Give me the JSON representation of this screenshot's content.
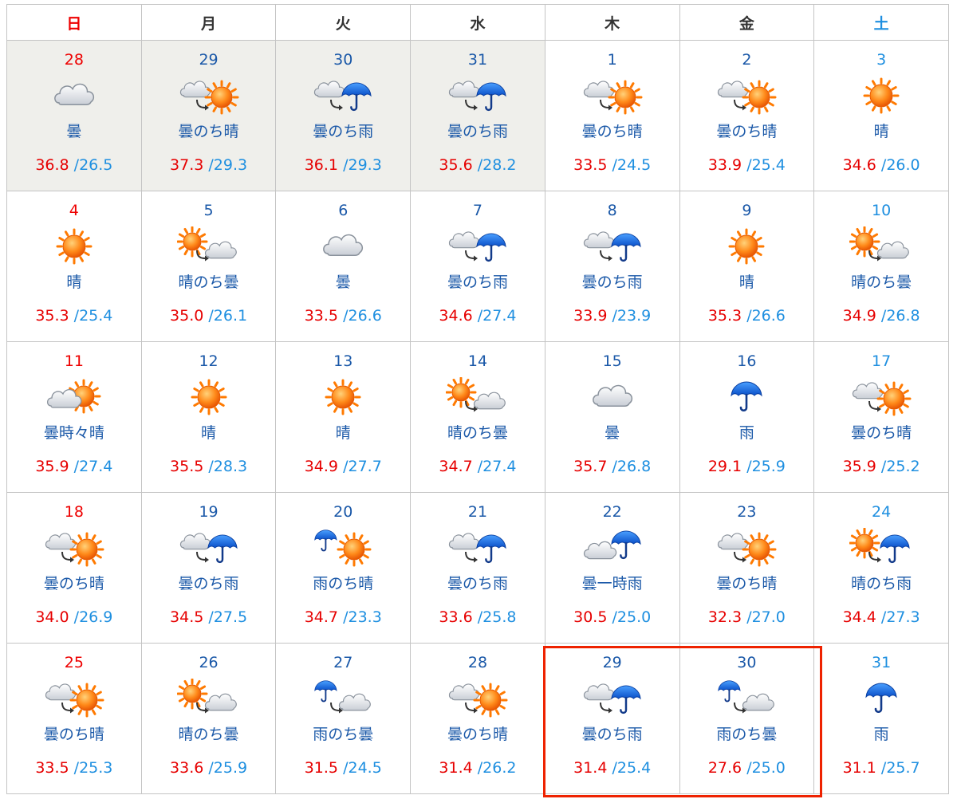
{
  "weekdays": [
    "日",
    "月",
    "火",
    "水",
    "木",
    "金",
    "土"
  ],
  "colors": {
    "sunday": "#ee0000",
    "saturday": "#1e8fe0",
    "weekday": "#1a58a8",
    "max_temp": "#e60000",
    "min_temp": "#1e8fe0",
    "past_bg": "#efefeb",
    "highlight": "#ee2200"
  },
  "weeks": [
    [
      {
        "day": "28",
        "icon": "cloud-icon",
        "label": "曇",
        "max": "36.8",
        "min": "/26.5",
        "past": true
      },
      {
        "day": "29",
        "icon": "cloud-then-sun-icon",
        "label": "曇のち晴",
        "max": "37.3",
        "min": "/29.3",
        "past": true
      },
      {
        "day": "30",
        "icon": "cloud-then-rain-icon",
        "label": "曇のち雨",
        "max": "36.1",
        "min": "/29.3",
        "past": true
      },
      {
        "day": "31",
        "icon": "cloud-then-rain-icon",
        "label": "曇のち雨",
        "max": "35.6",
        "min": "/28.2",
        "past": true
      },
      {
        "day": "1",
        "icon": "cloud-then-sun-icon",
        "label": "曇のち晴",
        "max": "33.5",
        "min": "/24.5",
        "past": false
      },
      {
        "day": "2",
        "icon": "cloud-then-sun-icon",
        "label": "曇のち晴",
        "max": "33.9",
        "min": "/25.4",
        "past": false
      },
      {
        "day": "3",
        "icon": "sun-icon",
        "label": "晴",
        "max": "34.6",
        "min": "/26.0",
        "past": false
      }
    ],
    [
      {
        "day": "4",
        "icon": "sun-icon",
        "label": "晴",
        "max": "35.3",
        "min": "/25.4",
        "past": false
      },
      {
        "day": "5",
        "icon": "sun-then-cloud-icon",
        "label": "晴のち曇",
        "max": "35.0",
        "min": "/26.1",
        "past": false
      },
      {
        "day": "6",
        "icon": "cloud-icon",
        "label": "曇",
        "max": "33.5",
        "min": "/26.6",
        "past": false
      },
      {
        "day": "7",
        "icon": "cloud-then-rain-icon",
        "label": "曇のち雨",
        "max": "34.6",
        "min": "/27.4",
        "past": false
      },
      {
        "day": "8",
        "icon": "cloud-then-rain-icon",
        "label": "曇のち雨",
        "max": "33.9",
        "min": "/23.9",
        "past": false
      },
      {
        "day": "9",
        "icon": "sun-icon",
        "label": "晴",
        "max": "35.3",
        "min": "/26.6",
        "past": false
      },
      {
        "day": "10",
        "icon": "sun-then-cloud-icon",
        "label": "晴のち曇",
        "max": "34.9",
        "min": "/26.8",
        "past": false
      }
    ],
    [
      {
        "day": "11",
        "icon": "cloud-sometimes-sun-icon",
        "label": "曇時々晴",
        "max": "35.9",
        "min": "/27.4",
        "past": false
      },
      {
        "day": "12",
        "icon": "sun-icon",
        "label": "晴",
        "max": "35.5",
        "min": "/28.3",
        "past": false
      },
      {
        "day": "13",
        "icon": "sun-icon",
        "label": "晴",
        "max": "34.9",
        "min": "/27.7",
        "past": false
      },
      {
        "day": "14",
        "icon": "sun-then-cloud-icon",
        "label": "晴のち曇",
        "max": "34.7",
        "min": "/27.4",
        "past": false
      },
      {
        "day": "15",
        "icon": "cloud-icon",
        "label": "曇",
        "max": "35.7",
        "min": "/26.8",
        "past": false
      },
      {
        "day": "16",
        "icon": "umbrella-icon",
        "label": "雨",
        "max": "29.1",
        "min": "/25.9",
        "past": false
      },
      {
        "day": "17",
        "icon": "cloud-then-sun-icon",
        "label": "曇のち晴",
        "max": "35.9",
        "min": "/25.2",
        "past": false
      }
    ],
    [
      {
        "day": "18",
        "icon": "cloud-then-sun-icon",
        "label": "曇のち晴",
        "max": "34.0",
        "min": "/26.9",
        "past": false
      },
      {
        "day": "19",
        "icon": "cloud-then-rain-icon",
        "label": "曇のち雨",
        "max": "34.5",
        "min": "/27.5",
        "past": false
      },
      {
        "day": "20",
        "icon": "rain-then-sun-icon",
        "label": "雨のち晴",
        "max": "34.7",
        "min": "/23.3",
        "past": false
      },
      {
        "day": "21",
        "icon": "cloud-then-rain-icon",
        "label": "曇のち雨",
        "max": "33.6",
        "min": "/25.8",
        "past": false
      },
      {
        "day": "22",
        "icon": "cloud-sometimes-rain-icon",
        "label": "曇一時雨",
        "max": "30.5",
        "min": "/25.0",
        "past": false
      },
      {
        "day": "23",
        "icon": "cloud-then-sun-icon",
        "label": "曇のち晴",
        "max": "32.3",
        "min": "/27.0",
        "past": false
      },
      {
        "day": "24",
        "icon": "sun-then-rain-icon",
        "label": "晴のち雨",
        "max": "34.4",
        "min": "/27.3",
        "past": false
      }
    ],
    [
      {
        "day": "25",
        "icon": "cloud-then-sun-icon",
        "label": "曇のち晴",
        "max": "33.5",
        "min": "/25.3",
        "past": false
      },
      {
        "day": "26",
        "icon": "sun-then-cloud-icon",
        "label": "晴のち曇",
        "max": "33.6",
        "min": "/25.9",
        "past": false
      },
      {
        "day": "27",
        "icon": "rain-then-cloud-icon",
        "label": "雨のち曇",
        "max": "31.5",
        "min": "/24.5",
        "past": false
      },
      {
        "day": "28",
        "icon": "cloud-then-sun-icon",
        "label": "曇のち晴",
        "max": "31.4",
        "min": "/26.2",
        "past": false
      },
      {
        "day": "29",
        "icon": "cloud-then-rain-icon",
        "label": "曇のち雨",
        "max": "31.4",
        "min": "/25.4",
        "past": false
      },
      {
        "day": "30",
        "icon": "rain-then-cloud-icon",
        "label": "雨のち曇",
        "max": "27.6",
        "min": "/25.0",
        "past": false
      },
      {
        "day": "31",
        "icon": "umbrella-icon",
        "label": "雨",
        "max": "31.1",
        "min": "/25.7",
        "past": false
      }
    ]
  ]
}
